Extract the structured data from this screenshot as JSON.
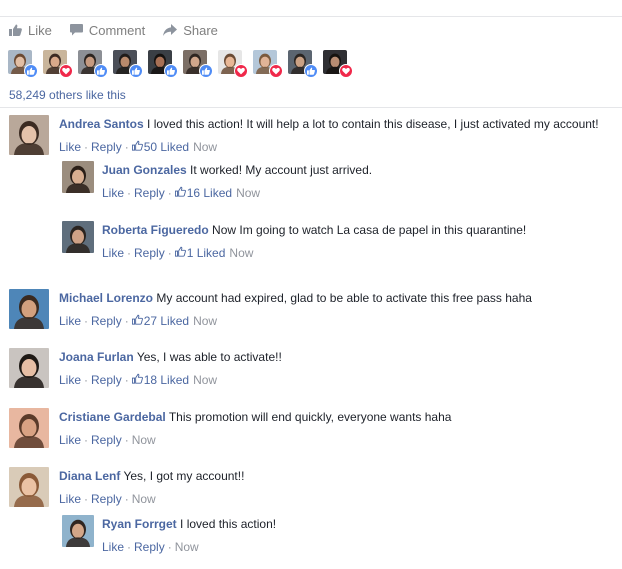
{
  "actions": {
    "like": "Like",
    "comment": "Comment",
    "share": "Share"
  },
  "likers": [
    {
      "reaction": "like",
      "bg": "#a9b7c6",
      "skin": "#e2bea4",
      "hair": "#6b4a33"
    },
    {
      "reaction": "love",
      "bg": "#c9b59b",
      "skin": "#d9a98a",
      "hair": "#3c2a22"
    },
    {
      "reaction": "like",
      "bg": "#8c8f95",
      "skin": "#c59a80",
      "hair": "#2b2420"
    },
    {
      "reaction": "like",
      "bg": "#4b4f58",
      "skin": "#b98a6c",
      "hair": "#1f1b19"
    },
    {
      "reaction": "like",
      "bg": "#3a3f45",
      "skin": "#a77055",
      "hair": "#151210"
    },
    {
      "reaction": "like",
      "bg": "#7c6f66",
      "skin": "#d0a68b",
      "hair": "#2e2520"
    },
    {
      "reaction": "love",
      "bg": "#e6e6e6",
      "skin": "#e8b796",
      "hair": "#6a4b35"
    },
    {
      "reaction": "love",
      "bg": "#b4c7d9",
      "skin": "#e0b497",
      "hair": "#7a5a3e"
    },
    {
      "reaction": "like",
      "bg": "#5b6570",
      "skin": "#caa184",
      "hair": "#2a2522"
    },
    {
      "reaction": "love",
      "bg": "#2f2f33",
      "skin": "#b88c72",
      "hair": "#15120f"
    }
  ],
  "likes_summary": "58,249 others like this",
  "meta_labels": {
    "like": "Like",
    "reply": "Reply",
    "sep": "·"
  },
  "comments": [
    {
      "author": "Andrea Santos",
      "text": "I loved this action! It will help a lot to contain this disease, I just activated my account!",
      "likes": "50 Liked",
      "time": "Now",
      "colors": {
        "bg": "#b9a89a",
        "skin": "#e4c2aa",
        "hair": "#3b2b22"
      }
    },
    {
      "author": "Juan Gonzales",
      "text": "It worked! My account just arrived.",
      "likes": "16 Liked",
      "time": "Now",
      "colors": {
        "bg": "#9b8d7e",
        "skin": "#d8ae90",
        "hair": "#2a1f18"
      }
    },
    {
      "author": "Roberta Figueredo",
      "text": "Now Im going to watch La casa de papel in this quarantine!",
      "likes": "1 Liked",
      "time": "Now",
      "colors": {
        "bg": "#5f6e7c",
        "skin": "#cfa286",
        "hair": "#2b241f"
      }
    },
    {
      "author": "Michael Lorenzo",
      "text": "My account had expired, glad to be able to activate this free pass haha",
      "likes": "27 Liked",
      "time": "Now",
      "colors": {
        "bg": "#4e86b8",
        "skin": "#d2a07e",
        "hair": "#3a2a20"
      }
    },
    {
      "author": "Joana Furlan",
      "text": "Yes, I was able to activate!!",
      "likes": "18 Liked",
      "time": "Now",
      "colors": {
        "bg": "#c9c4c0",
        "skin": "#e6bea4",
        "hair": "#1e1915"
      }
    },
    {
      "author": "Cristiane Gardebal",
      "text": "This promotion will end quickly, everyone wants haha",
      "likes": "",
      "time": "Now",
      "colors": {
        "bg": "#e8b7a0",
        "skin": "#d9a283",
        "hair": "#5a3b2a"
      }
    },
    {
      "author": "Diana Lenf",
      "text": "Yes, I got my account!!",
      "likes": "",
      "time": "Now",
      "colors": {
        "bg": "#d9cbb8",
        "skin": "#ebc2a4",
        "hair": "#8a5a38"
      }
    },
    {
      "author": "Ryan Forrget",
      "text": "I loved this action!",
      "likes": "",
      "time": "Now",
      "colors": {
        "bg": "#8fb3cc",
        "skin": "#d3a688",
        "hair": "#2f2520"
      }
    }
  ]
}
